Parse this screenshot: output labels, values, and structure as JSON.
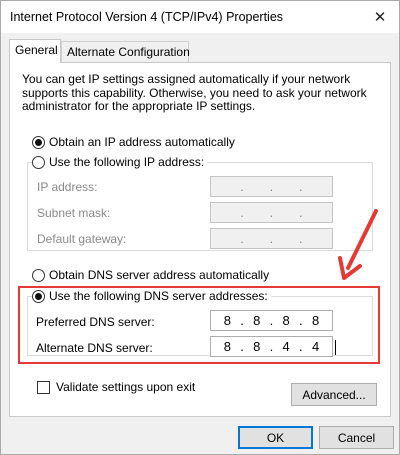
{
  "window": {
    "title": "Internet Protocol Version 4 (TCP/IPv4) Properties"
  },
  "tabs": [
    {
      "label": "General",
      "active": true
    },
    {
      "label": "Alternate Configuration",
      "active": false
    }
  ],
  "intro_text": "You can get IP settings assigned automatically if your network supports this capability. Otherwise, you need to ask your network administrator for the appropriate IP settings.",
  "ip": {
    "auto_label": "Obtain an IP address automatically",
    "auto_checked": true,
    "manual_label": "Use the following IP address:",
    "manual_checked": false,
    "fields": [
      {
        "label": "IP address:",
        "value": [
          ".",
          ".",
          "."
        ]
      },
      {
        "label": "Subnet mask:",
        "value": [
          ".",
          ".",
          "."
        ]
      },
      {
        "label": "Default gateway:",
        "value": [
          ".",
          ".",
          "."
        ]
      }
    ]
  },
  "dns": {
    "auto_label": "Obtain DNS server address automatically",
    "auto_checked": false,
    "manual_label": "Use the following DNS server addresses:",
    "manual_checked": true,
    "preferred": {
      "label": "Preferred DNS server:",
      "octets": [
        "8",
        "8",
        "8",
        "8"
      ]
    },
    "alternate": {
      "label": "Alternate DNS server:",
      "octets": [
        "8",
        "8",
        "4",
        "4"
      ]
    }
  },
  "validate": {
    "label": "Validate settings upon exit",
    "checked": false
  },
  "buttons": {
    "advanced": "Advanced...",
    "ok": "OK",
    "cancel": "Cancel"
  },
  "colors": {
    "highlight": "#e53935",
    "focus_blue": "#0078d7"
  },
  "icons": {
    "close": "close-icon",
    "annotation": "arrow-annotation-icon"
  }
}
